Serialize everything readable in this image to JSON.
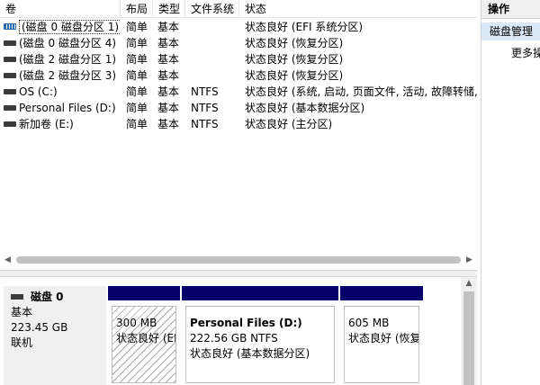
{
  "volume_list": {
    "columns": [
      "卷",
      "布局",
      "类型",
      "文件系统",
      "状态"
    ],
    "rows": [
      {
        "volume": "(磁盘 0 磁盘分区 1)",
        "layout": "简单",
        "type": "基本",
        "fs": "",
        "status": "状态良好 (EFI 系统分区)",
        "icon": "efi-volume-icon"
      },
      {
        "volume": "(磁盘 0 磁盘分区 4)",
        "layout": "简单",
        "type": "基本",
        "fs": "",
        "status": "状态良好 (恢复分区)",
        "icon": "volume-icon"
      },
      {
        "volume": "(磁盘 2 磁盘分区 1)",
        "layout": "简单",
        "type": "基本",
        "fs": "",
        "status": "状态良好 (恢复分区)",
        "icon": "volume-icon"
      },
      {
        "volume": "(磁盘 2 磁盘分区 3)",
        "layout": "简单",
        "type": "基本",
        "fs": "",
        "status": "状态良好 (恢复分区)",
        "icon": "volume-icon"
      },
      {
        "volume": "OS (C:)",
        "layout": "简单",
        "type": "基本",
        "fs": "NTFS",
        "status": "状态良好 (系统, 启动, 页面文件, 活动, 故障转储,",
        "icon": "volume-icon"
      },
      {
        "volume": "Personal Files (D:)",
        "layout": "简单",
        "type": "基本",
        "fs": "NTFS",
        "status": "状态良好 (基本数据分区)",
        "icon": "volume-icon"
      },
      {
        "volume": "新加卷 (E:)",
        "layout": "简单",
        "type": "基本",
        "fs": "NTFS",
        "status": "状态良好 (主分区)",
        "icon": "volume-icon"
      }
    ]
  },
  "disk_view": {
    "disk": {
      "title": "磁盘 0",
      "type": "基本",
      "size": "223.45 GB",
      "state": "联机"
    },
    "partitions": [
      {
        "name": "",
        "size": "300 MB",
        "status": "状态良好 (EFI"
      },
      {
        "name": "Personal Files  (D:)",
        "size": "222.56 GB NTFS",
        "status": "状态良好 (基本数据分区)"
      },
      {
        "name": "",
        "size": "605 MB",
        "status": "状态良好 (恢复"
      }
    ]
  },
  "actions": {
    "header": "操作",
    "section": "磁盘管理",
    "more": "更多操"
  },
  "colors": {
    "partition_bar": "#07006b",
    "action_selected_bg": "#dae7f5"
  }
}
